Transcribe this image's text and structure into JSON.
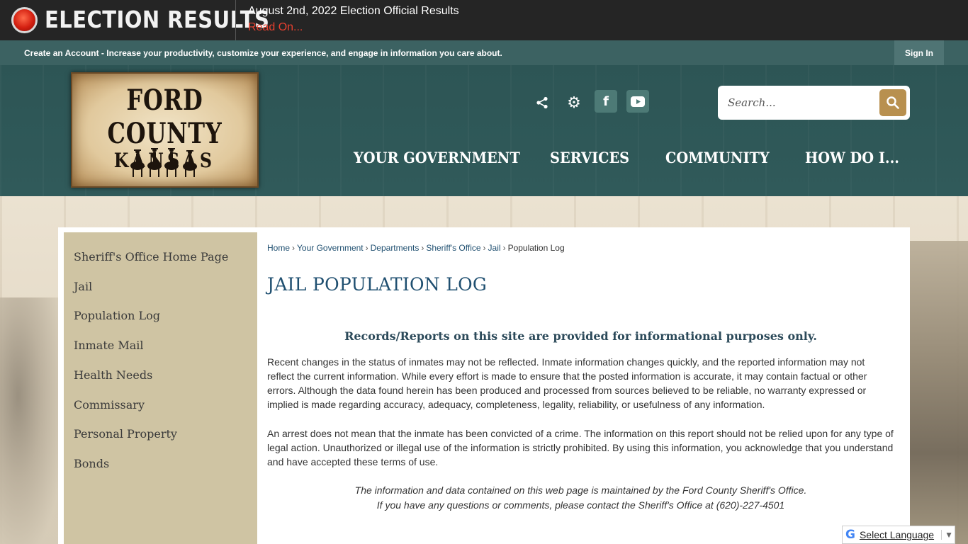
{
  "alert": {
    "title": "ELECTION RESULTS",
    "headline": "August 2nd, 2022 Election Official Results",
    "link": "Read On..."
  },
  "account_bar": {
    "text": "Create an Account - Increase your productivity, customize your experience, and engage in information you care about.",
    "sign_in": "Sign In"
  },
  "logo": {
    "line1": "FORD COUNTY",
    "line2": "KANSAS"
  },
  "utility_icons": [
    "share-icon",
    "gear-icon",
    "facebook-icon",
    "youtube-icon"
  ],
  "facebook_glyph": "f",
  "search": {
    "placeholder": "Search..."
  },
  "nav": [
    "YOUR GOVERNMENT",
    "SERVICES",
    "COMMUNITY",
    "HOW DO I..."
  ],
  "sidebar": {
    "items": [
      "Sheriff's Office Home Page",
      "Jail",
      "Population Log",
      "Inmate Mail",
      "Health Needs",
      "Commissary",
      "Personal Property",
      "Bonds"
    ]
  },
  "breadcrumb": {
    "links": [
      "Home",
      "Your Government",
      "Departments",
      "Sheriff's Office",
      "Jail"
    ],
    "current": "Population Log"
  },
  "page_title": "JAIL POPULATION LOG",
  "notice": "Records/Reports on this site are provided for informational purposes only.",
  "paragraphs": [
    "Recent changes in the status of inmates may not be reflected. Inmate information changes quickly, and the reported information may not reflect the current information. While every effort is made to ensure that the posted information is accurate, it may contain factual or other errors. Although the data found herein has been produced and processed from sources believed to be reliable, no warranty expressed or implied is made regarding accuracy, adequacy, completeness, legality, reliability, or usefulness of any information.",
    "An arrest does not mean that the inmate has been convicted of a crime. The information on this report should not be relied upon for any type of legal action. Unauthorized or illegal use of the information is strictly prohibited. By using this information, you acknowledge that you understand and have accepted these terms of use."
  ],
  "footnotes": [
    "The information and data contained on this web page is maintained by the Ford County Sheriff's Office.",
    "If you have any questions or comments, please contact the Sheriff's Office at (620)-227-4501"
  ],
  "translate": {
    "label": "Select Language"
  },
  "colors": {
    "header_teal": "#305a5a",
    "account_bar": "#3c6262",
    "alert_red": "#e8402f",
    "search_button": "#b8904f",
    "sidebar": "#cfc4a3",
    "title_blue": "#1f4f70"
  }
}
